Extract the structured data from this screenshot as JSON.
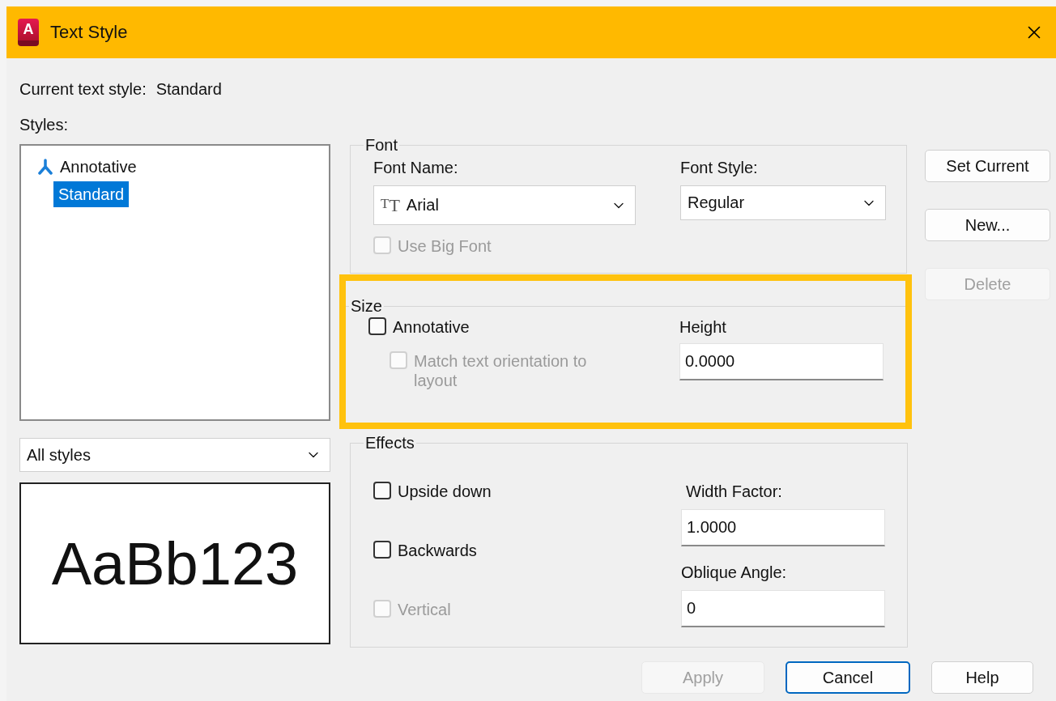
{
  "window": {
    "title": "Text Style",
    "icon_letter": "A"
  },
  "current_style": {
    "label": "Current text style:",
    "value": "Standard"
  },
  "styles": {
    "label": "Styles:",
    "items": [
      {
        "name": "Annotative",
        "annotative": true,
        "selected": false
      },
      {
        "name": "Standard",
        "annotative": false,
        "selected": true
      }
    ]
  },
  "style_filter": {
    "value": "All styles"
  },
  "preview": {
    "text": "AaBb123"
  },
  "font": {
    "title": "Font",
    "font_name": {
      "label": "Font Name:",
      "type_icon": [
        "T",
        "T"
      ],
      "value": "Arial"
    },
    "font_style": {
      "label": "Font Style:",
      "value": "Regular"
    },
    "use_big_font": {
      "label": "Use Big Font",
      "checked": false,
      "disabled": true
    }
  },
  "size": {
    "title": "Size",
    "highlighted": true,
    "annotative": {
      "label": "Annotative",
      "checked": false,
      "disabled": false
    },
    "match_orientation": {
      "label": "Match text orientation to layout",
      "checked": false,
      "disabled": true
    },
    "height": {
      "label": "Height",
      "value": "0.0000"
    }
  },
  "effects": {
    "title": "Effects",
    "checkboxes": [
      {
        "label": "Upside down",
        "checked": false,
        "disabled": false
      },
      {
        "label": "Backwards",
        "checked": false,
        "disabled": false
      },
      {
        "label": "Vertical",
        "checked": false,
        "disabled": true
      }
    ],
    "width_factor": {
      "label": "Width Factor:",
      "value": "1.0000"
    },
    "oblique_angle": {
      "label": "Oblique Angle:",
      "value": "0"
    }
  },
  "side_buttons": [
    {
      "label": "Set Current",
      "disabled": false
    },
    {
      "label": "New...",
      "disabled": false
    },
    {
      "label": "Delete",
      "disabled": true
    }
  ],
  "footer_buttons": [
    {
      "label": "Apply",
      "disabled": true,
      "focused": false
    },
    {
      "label": "Cancel",
      "disabled": false,
      "focused": true
    },
    {
      "label": "Help",
      "disabled": false,
      "focused": false
    }
  ]
}
